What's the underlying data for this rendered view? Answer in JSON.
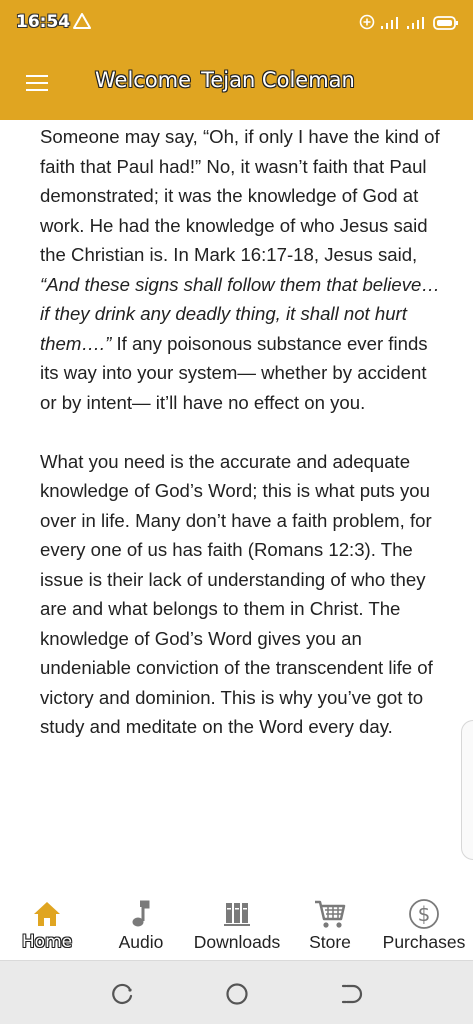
{
  "status_bar": {
    "time": "16:54",
    "icons": [
      "warning-icon",
      "data-saver-icon",
      "signal-icon",
      "signal-icon",
      "battery-icon"
    ]
  },
  "app_bar": {
    "menu_icon": "hamburger-menu-icon",
    "title_word1": "Welcome",
    "title_word2": "Tejan Coleman"
  },
  "article": {
    "paragraph1_plain_start": "Someone may say, “Oh, if only I have the kind of faith that Paul had!” No, it wasn’t faith that Paul demonstrated; it was the knowledge of God at work. He had the knowledge of who Jesus said the Christian is. In Mark 16:17-18, Jesus said, ",
    "paragraph1_quote": "“And these signs shall follow them that believe…if they drink any deadly thing, it shall not hurt them….”",
    "paragraph1_plain_end": " If any poisonous substance ever finds its way into your system— whether by accident or by intent— it’ll have no effect on you.",
    "paragraph2": "What you need is the accurate and adequate knowledge of God’s Word; this is what puts you over in life. Many don’t have a faith problem, for every one of us has faith (Romans 12:3). The issue is their lack of understanding of who they are and what belongs to them in Christ. The knowledge of God’s Word gives you an undeniable conviction of the transcendent life of victory and dominion. This is why you’ve got to study and meditate on the Word every day."
  },
  "bottom_nav": {
    "items": [
      {
        "label": "Home",
        "icon": "home-icon",
        "active": true
      },
      {
        "label": "Audio",
        "icon": "music-note-icon",
        "active": false
      },
      {
        "label": "Downloads",
        "icon": "library-books-icon",
        "active": false
      },
      {
        "label": "Store",
        "icon": "shopping-cart-icon",
        "active": false
      },
      {
        "label": "Purchases",
        "icon": "dollar-circle-icon",
        "active": false
      }
    ]
  },
  "system_nav": {
    "icons": [
      "recents-icon",
      "home-circle-icon",
      "back-icon"
    ]
  },
  "colors": {
    "accent": "#e0a521",
    "text": "#222222",
    "inactive_icon": "#7a7a7a",
    "system_bar": "#eaeaea"
  }
}
